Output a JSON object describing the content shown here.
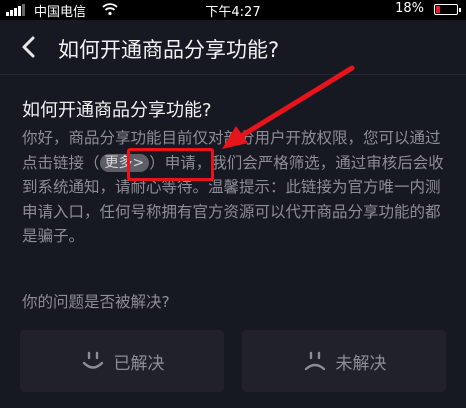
{
  "status_bar": {
    "carrier": "中国电信",
    "time": "下午4:27",
    "battery": "18%",
    "battery_level": 0.18,
    "battery_color": "#e0232c"
  },
  "nav": {
    "back_icon": "chevron-left-icon",
    "title": "如何开通商品分享功能?"
  },
  "article": {
    "title": "如何开通商品分享功能?",
    "body_before": "你好，商品分享功能目前仅对部分用户开放权限，您可以通过点击链接（",
    "more_link": "更多>",
    "body_after": "）申请，我们会严格筛选，通过审核后会收到系统通知，请耐心等待。温馨提示：此链接为官方唯一内测申请入口，任何号称拥有官方资源可以代开商品分享功能的都是骗子。"
  },
  "feedback": {
    "question": "你的问题是否被解决?",
    "solved": "已解决",
    "unsolved": "未解决",
    "solved_icon": "smile-face-icon",
    "unsolved_icon": "sad-face-icon"
  },
  "annotation": {
    "color": "#e8141c"
  }
}
